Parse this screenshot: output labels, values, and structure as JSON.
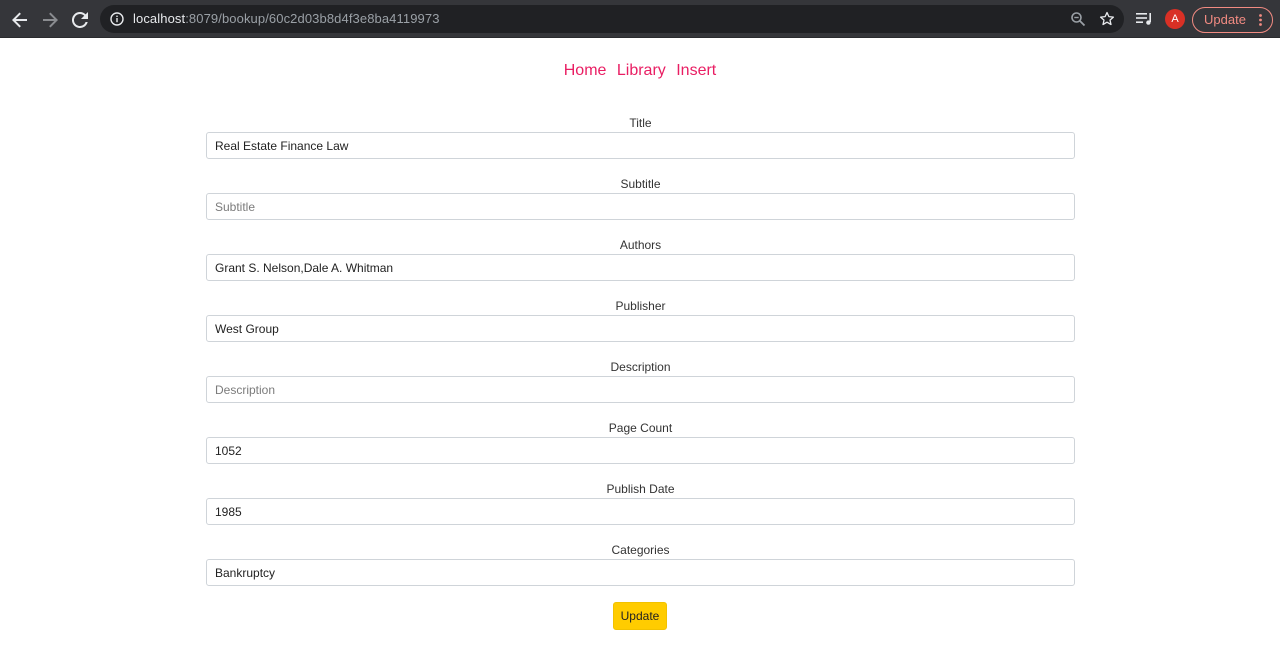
{
  "browser": {
    "url_host": "localhost",
    "url_path": ":8079/bookup/60c2d03b8d4f3e8ba4119973",
    "avatar_letter": "A",
    "update_label": "Update",
    "icons": [
      "back-arrow-icon",
      "forward-arrow-icon",
      "reload-icon",
      "info-icon",
      "zoom-icon",
      "star-icon",
      "media-queue-icon",
      "kebab-menu-icon"
    ],
    "accent_color": "#f28b82"
  },
  "nav": {
    "links": [
      "Home",
      "Library",
      "Insert"
    ],
    "link_color": "#e91e63"
  },
  "form": {
    "fields": [
      {
        "label": "Title",
        "value": "Real Estate Finance Law",
        "placeholder": "Title"
      },
      {
        "label": "Subtitle",
        "value": "",
        "placeholder": "Subtitle"
      },
      {
        "label": "Authors",
        "value": "Grant S. Nelson,Dale A. Whitman",
        "placeholder": "Authors"
      },
      {
        "label": "Publisher",
        "value": "West Group",
        "placeholder": "Publisher"
      },
      {
        "label": "Description",
        "value": "",
        "placeholder": "Description"
      },
      {
        "label": "Page Count",
        "value": "1052",
        "placeholder": "Page Count"
      },
      {
        "label": "Publish Date",
        "value": "1985",
        "placeholder": "Publish Date"
      },
      {
        "label": "Categories",
        "value": "Bankruptcy",
        "placeholder": "Categories"
      }
    ],
    "submit_label": "Update",
    "submit_color": "#ffcc00"
  }
}
